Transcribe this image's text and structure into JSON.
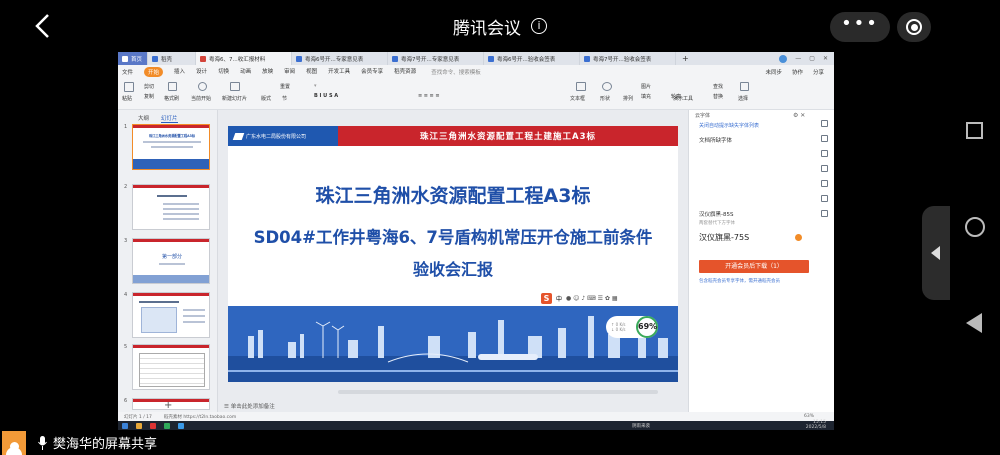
{
  "meeting": {
    "title": "腾讯会议",
    "info_icon": "info-icon",
    "more_label": "•••",
    "sharer_status": "樊海华的屏幕共享"
  },
  "wps": {
    "tabs": [
      {
        "label": "首页",
        "kind": "home"
      },
      {
        "label": "稻壳",
        "kind": "doc"
      },
      {
        "label": "粤海6、7...收汇报材料",
        "kind": "active"
      },
      {
        "label": "粤海6号开...专家意见表",
        "kind": "doc"
      },
      {
        "label": "粤海7号开...专家意见表",
        "kind": "doc"
      },
      {
        "label": "粤海6号开...验收会签表",
        "kind": "doc"
      },
      {
        "label": "粤海7号开...验收会签表",
        "kind": "doc"
      }
    ],
    "tab_add": "+",
    "menu": {
      "file": "文件",
      "items": [
        "开始",
        "插入",
        "设计",
        "切换",
        "动画",
        "放映",
        "审阅",
        "视图",
        "开发工具",
        "会员专享",
        "稻壳资源"
      ],
      "search": "查找命令、搜索模板",
      "unsynced": "未同步",
      "collab": "协作",
      "share": "分享"
    },
    "ribbon": {
      "cut": "剪切",
      "copy": "复制",
      "paste": "粘贴",
      "format_painter": "格式刷",
      "start_from_current": "当前开始",
      "new_slide": "新建幻灯片",
      "layout": "版式",
      "section": "节",
      "reset": "重置",
      "textbox": "文本框",
      "shape": "形状",
      "arrange": "排列",
      "picture": "图片",
      "fill": "填充",
      "outline": "轮廓",
      "find": "查找",
      "replace": "替换",
      "select": "选择",
      "presenter_tools": "演示工具"
    },
    "left_panel": {
      "tab_outline": "大纲",
      "tab_slides": "幻灯片",
      "thumbs": [
        {
          "num": "1",
          "title": "珠江三角洲水资源配置工程A3标",
          "selected": true
        },
        {
          "num": "2",
          "title": "",
          "selected": false
        },
        {
          "num": "3",
          "title": "第一部分",
          "selected": false
        },
        {
          "num": "4",
          "title": "",
          "selected": false
        },
        {
          "num": "5",
          "title": "",
          "selected": false
        },
        {
          "num": "6",
          "title": "",
          "selected": false
        }
      ],
      "add": "+"
    },
    "slide": {
      "company": "广东水电二局股份有限公司",
      "banner": "珠江三角洲水资源配置工程土建施工A3标",
      "title1": "珠江三角洲水资源配置工程A3标",
      "title2": "SD04#工作井粤海6、7号盾构机常压开仓施工前条件",
      "title3": "验收会汇报"
    },
    "ime": {
      "logo": "S",
      "label": "中"
    },
    "speed": {
      "up": "↑ 0 K/s",
      "down": "↓ 0 K/s",
      "percent": "69%"
    },
    "notes_placeholder": "单击此处添加备注",
    "right_panel": {
      "header": "云字体",
      "link1": "关闭自动提示缺失字体列表",
      "section": "文档所缺字体",
      "font1": "汉仪旗黑-85S",
      "font1_note": "两套替代下方字体",
      "font2": "汉仪旗黑-75S",
      "button": "开通会员后下载（1）",
      "note": "包含稻壳会员专享字体，需开通稻壳会员"
    },
    "status": {
      "slide_info": "幻灯片 1 / 17",
      "theme": "稻壳素材 https://t2ln.taobao.com",
      "zoom": "63%"
    },
    "taskbar": {
      "weather": "阴雨来袭",
      "time": "15:15",
      "date": "2022/5/8"
    }
  },
  "colors": {
    "accent_orange": "#f28c28",
    "slide_blue": "#1f4fa8",
    "slide_red": "#c9252c",
    "button_red": "#e5542b"
  }
}
